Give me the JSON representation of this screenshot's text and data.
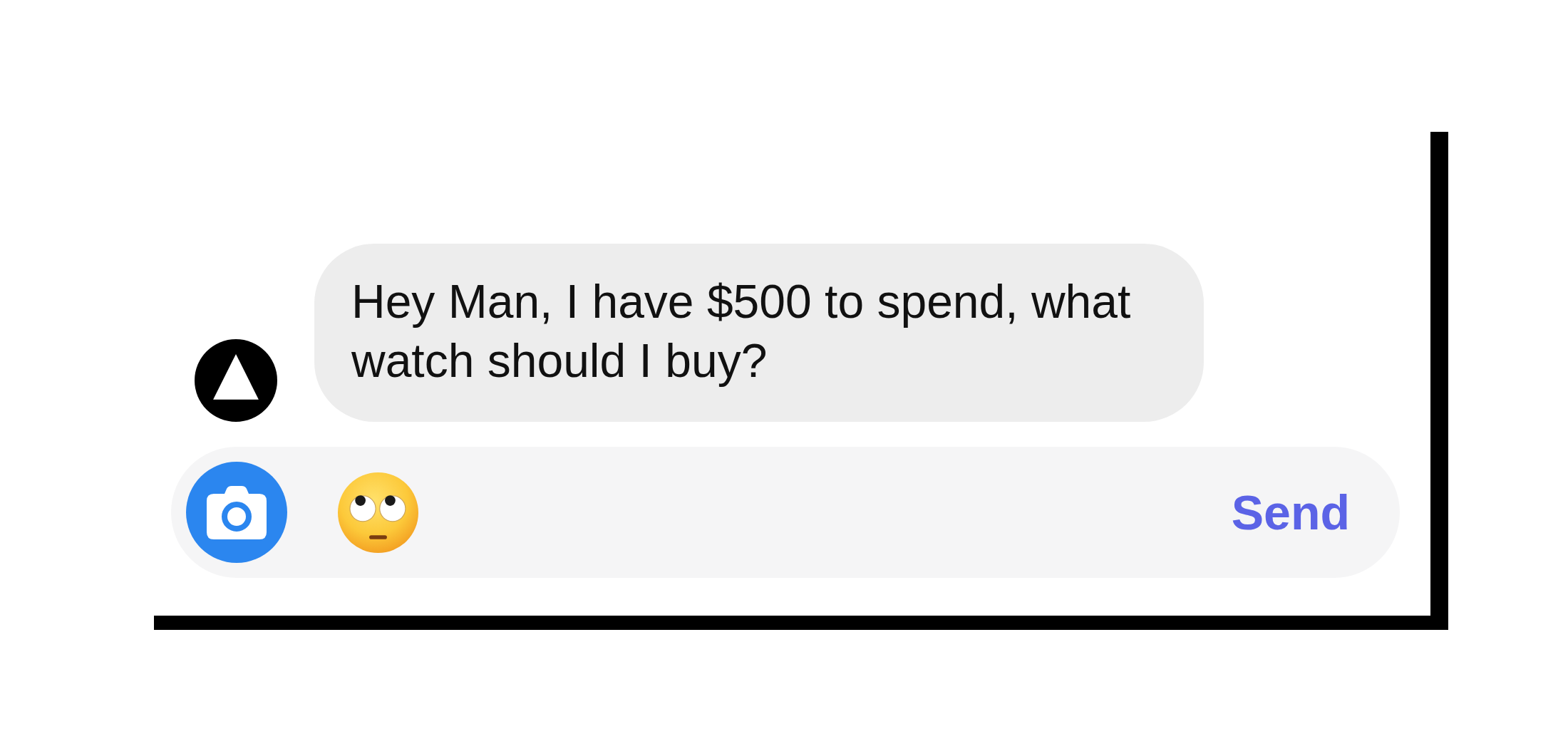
{
  "message": {
    "text": "Hey Man, I have $500 to spend, what watch should I buy?"
  },
  "composer": {
    "send_label": "Send"
  }
}
